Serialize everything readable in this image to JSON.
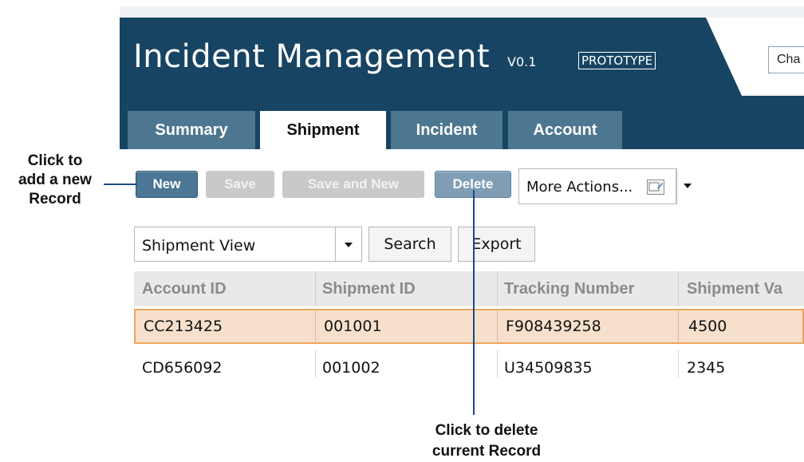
{
  "app": {
    "title": "Incident Management",
    "version": "V0.1",
    "badge": "PROTOTYPE",
    "search_partial": "Cha"
  },
  "tabs": [
    {
      "label": "Summary",
      "active": false
    },
    {
      "label": "Shipment",
      "active": true
    },
    {
      "label": "Incident",
      "active": false
    },
    {
      "label": "Account",
      "active": false
    }
  ],
  "toolbar": {
    "new_label": "New",
    "save_label": "Save",
    "save_new_label": "Save and New",
    "delete_label": "Delete",
    "more_actions_label": "More Actions..."
  },
  "grid": {
    "view_label": "Shipment View",
    "search_label": "Search",
    "export_label": "Export",
    "headers": [
      "Account ID",
      "Shipment ID",
      "Tracking Number",
      "Shipment Va"
    ],
    "rows": [
      {
        "selected": true,
        "cells": [
          "CC213425",
          "001001",
          "F908439258",
          "4500"
        ]
      },
      {
        "selected": false,
        "cells": [
          "CD656092",
          "001002",
          "U34509835",
          "2345"
        ]
      }
    ]
  },
  "annotations": {
    "left_line1": "Click to",
    "left_line2": "add a new",
    "left_line3": "Record",
    "bottom_line1": "Click to delete",
    "bottom_line2": "current Record"
  },
  "colors": {
    "header": "#174463",
    "tab_inactive": "#4d7790",
    "primary_button": "#4b7795",
    "disabled_button": "#c7c9cb",
    "selected_row": "#f7e0cb",
    "selected_border": "#f0a45b",
    "callout_line": "#1b4a88"
  },
  "icons": {
    "more_actions": "edit-window-icon",
    "dropdown": "caret-down-icon"
  }
}
